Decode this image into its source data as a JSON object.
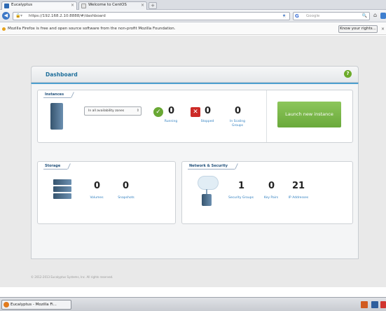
{
  "browser": {
    "tabs": [
      {
        "label": "Eucalyptus"
      },
      {
        "label": "Welcome to CentOS"
      }
    ],
    "tab_close": "×",
    "new_tab": "+",
    "url": "https://192.168.2.10:8888/#/dashboard",
    "search_placeholder": "Google",
    "star": "☆",
    "lock": "🔒",
    "site_icon": "▾",
    "download_icon": "▾",
    "search_logo": "G",
    "search_icon": "🔍",
    "home_icon": "⌂",
    "notice_text": "Mozilla Firefox is free and open source software from the non-profit Mozilla Foundation.",
    "know_rights_label": "Know your rights...",
    "notice_close": "×"
  },
  "dashboard": {
    "title": "Dashboard",
    "help_label": "?",
    "instances": {
      "section_label": "Instances",
      "zone_select_value": "In all availability zones",
      "zone_spin": "⇕",
      "running_icon": "✓",
      "running_count": "0",
      "running_label": "Running",
      "stopped_icon": "✕",
      "stopped_count": "0",
      "stopped_label": "Stopped",
      "scaling_count": "0",
      "scaling_label": "In Scaling Groups",
      "launch_label": "Launch new instance"
    },
    "storage": {
      "section_label": "Storage",
      "volumes_count": "0",
      "volumes_label": "Volumes",
      "snapshots_count": "0",
      "snapshots_label": "Snapshots"
    },
    "network": {
      "section_label": "Network & Security",
      "security_groups_count": "1",
      "security_groups_label": "Security Groups",
      "key_pairs_count": "0",
      "key_pairs_label": "Key Pairs",
      "ip_addresses_count": "21",
      "ip_addresses_label": "IP Addresses"
    },
    "footer": "© 2012-2013 Eucalyptus Systems, Inc. All rights reserved."
  },
  "taskbar": {
    "window_label": "Eucalyptus - Mozilla Fi..."
  }
}
